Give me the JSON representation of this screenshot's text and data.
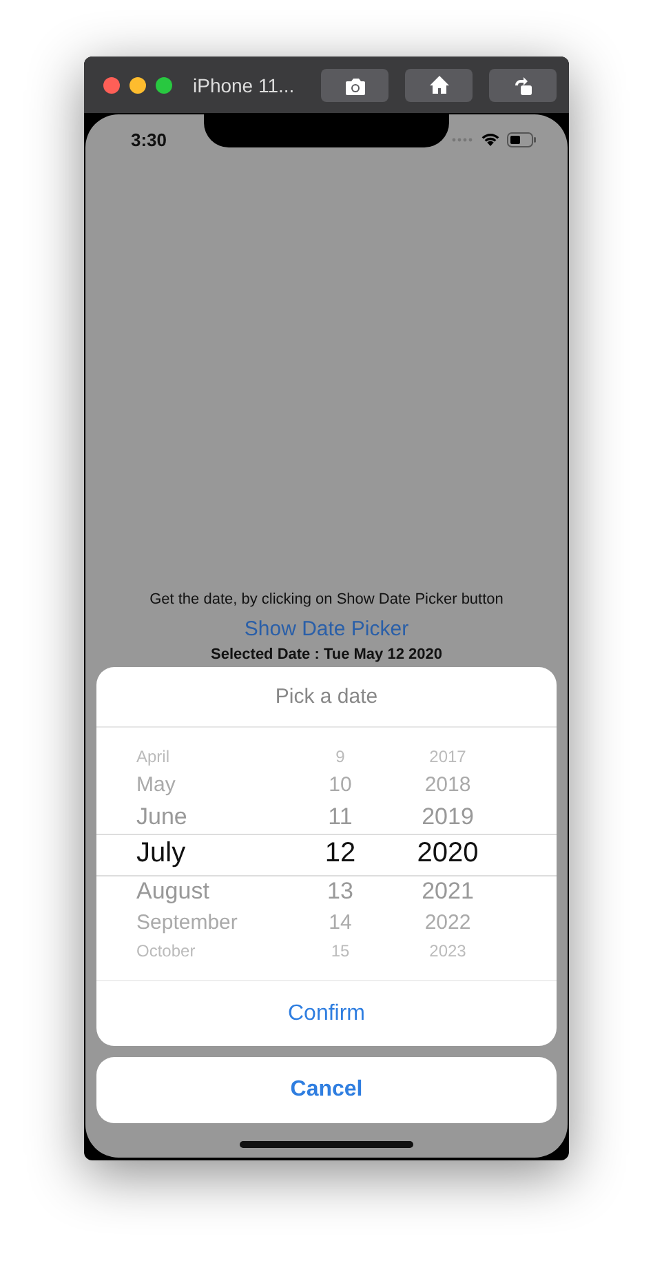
{
  "window": {
    "title": "iPhone 11..."
  },
  "status_bar": {
    "time": "3:30"
  },
  "content": {
    "prompt": "Get the date, by clicking on Show Date Picker button",
    "link": "Show Date Picker",
    "selected_date": "Selected Date : Tue May 12 2020"
  },
  "sheet": {
    "title": "Pick a date",
    "columns": [
      {
        "items": [
          {
            "label": "April",
            "selected": false
          },
          {
            "label": "May",
            "selected": false
          },
          {
            "label": "June",
            "selected": false
          },
          {
            "label": "July",
            "selected": true
          },
          {
            "label": "August",
            "selected": false
          },
          {
            "label": "September",
            "selected": false
          },
          {
            "label": "October",
            "selected": false
          }
        ]
      },
      {
        "items": [
          {
            "label": "9",
            "selected": false
          },
          {
            "label": "10",
            "selected": false
          },
          {
            "label": "11",
            "selected": false
          },
          {
            "label": "12",
            "selected": true
          },
          {
            "label": "13",
            "selected": false
          },
          {
            "label": "14",
            "selected": false
          },
          {
            "label": "15",
            "selected": false
          }
        ]
      },
      {
        "items": [
          {
            "label": "2017",
            "selected": false
          },
          {
            "label": "2018",
            "selected": false
          },
          {
            "label": "2019",
            "selected": false
          },
          {
            "label": "2020",
            "selected": true
          },
          {
            "label": "2021",
            "selected": false
          },
          {
            "label": "2022",
            "selected": false
          },
          {
            "label": "2023",
            "selected": false
          }
        ]
      }
    ],
    "confirm": "Confirm"
  },
  "cancel": "Cancel"
}
